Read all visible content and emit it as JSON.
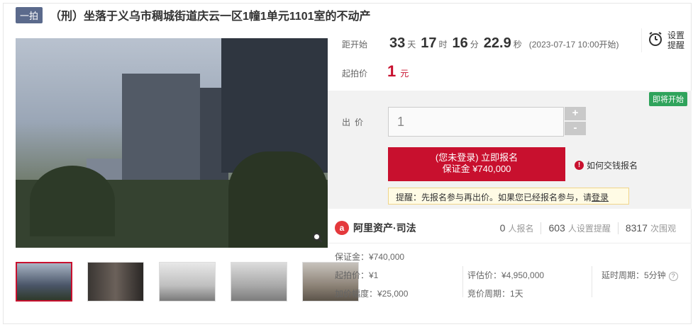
{
  "header": {
    "badge": "一拍",
    "title": "（刑）坐落于义乌市稠城街道庆云一区1幢1单元1101室的不动产"
  },
  "countdown": {
    "label": "距开始",
    "days": "33",
    "days_unit": "天",
    "hours": "17",
    "hours_unit": "时",
    "minutes": "16",
    "minutes_unit": "分",
    "seconds": "22.9",
    "seconds_unit": "秒",
    "start": "(2023-07-17 10:00开始)"
  },
  "remind": {
    "label": "设置提醒"
  },
  "start_price": {
    "label": "起拍价",
    "value": "1",
    "unit": "元"
  },
  "bid": {
    "status_badge": "即将开始",
    "label": "出价",
    "input_value": "1",
    "plus": "+",
    "minus": "-",
    "register_line1": "(您未登录) 立即报名",
    "register_line2": "保证金 ¥740,000",
    "pay_help": "如何交钱报名",
    "tip_text": "提醒：先报名参与再出价。如果您已经报名参与，请",
    "tip_link": "登录"
  },
  "platform": {
    "name": "阿里资产·司法",
    "registered": "0",
    "registered_label": "人报名",
    "reminders": "603",
    "reminders_label": "人设置提醒",
    "views": "8317",
    "views_label": "次围观"
  },
  "details": {
    "deposit": "保证金：¥740,000",
    "start_price": "起拍价：¥1",
    "valuation": "评估价：¥4,950,000",
    "delay": "延时周期：5分钟",
    "increment": "加价幅度：¥25,000",
    "cycle": "竞价周期：1天"
  },
  "colors": {
    "accent": "#c8102e",
    "badge": "#5b6a8c",
    "green": "#2fa35b"
  }
}
